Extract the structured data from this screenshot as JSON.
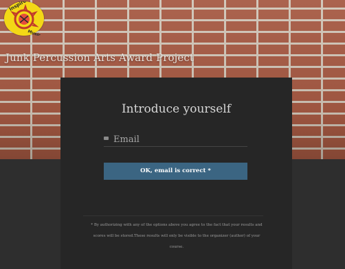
{
  "header": {
    "logo_icon": "inspire-music-logo",
    "logo_text": "Inspire Music",
    "site_title": "Junk Percussion Arts Award Project"
  },
  "panel": {
    "title": "Introduce yourself",
    "email_placeholder": "Email",
    "confirm_label": "OK, email is correct *",
    "legal_text": "* By authorizing with any of the options above you agree to the fact that your results and scores will be stored.These results will only be visible to the organizer (author) of your course."
  },
  "colors": {
    "button": "#3b6582",
    "panel": "#262626",
    "logo": "#f3d816"
  }
}
